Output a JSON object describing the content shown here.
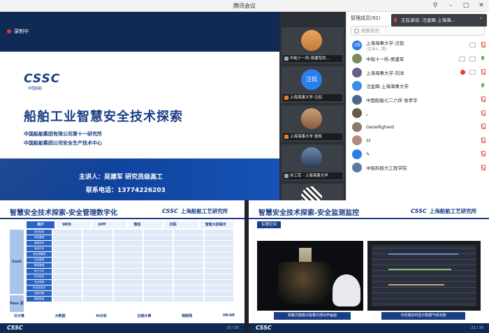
{
  "window": {
    "title": "腾讯会议"
  },
  "recording": {
    "label": "录制中"
  },
  "main_slide": {
    "logo_text": "CSSC",
    "logo_sub": "中国船舶",
    "title": "船舶工业智慧安全技术探索",
    "org_line1": "中国船舶集团有限公司第十一研究所",
    "org_line2": "中国船舶集团公司安全生产技术中心",
    "speaker": "主讲人：吴建军    研究员级高工",
    "phone": "联系电话：13774226203"
  },
  "video_tiles": [
    {
      "caption": "中船十一所-吴建军的..."
    },
    {
      "caption": "上海海事大学-汪侃",
      "avatar_text": "汪侃"
    },
    {
      "caption": "上海海事大学 张辉"
    },
    {
      "caption": "刘工军 · 上海海事大学"
    }
  ],
  "panel": {
    "header": "管理成员(92)",
    "search_placeholder": "搜索成员",
    "participants": [
      {
        "name": "上海海事大学-汪侃",
        "sub": "(主持人, 我)",
        "avatar": "汪侃",
        "color": "#2b7de9"
      },
      {
        "name": "中船十一所-吴建军",
        "sub": "",
        "avatar": "",
        "color": "#7a8c5c"
      },
      {
        "name": "上海海事大学-刘洋",
        "sub": "",
        "avatar": "",
        "color": "#6b5e8a"
      },
      {
        "name": "汪金辉-上海海事大学",
        "sub": "",
        "avatar": "汪金辉",
        "color": "#3a8de0"
      },
      {
        "name": "中国船舶七二六所 张孝华",
        "sub": "",
        "avatar": "",
        "color": "#4a6a8a"
      },
      {
        "name": "。",
        "sub": "",
        "avatar": "",
        "color": "#6a5a4a"
      },
      {
        "name": "Gezelligheid",
        "sub": "",
        "avatar": "",
        "color": "#8a7a6a"
      },
      {
        "name": "zz",
        "sub": "",
        "avatar": "",
        "color": "#b08a7a"
      },
      {
        "name": "✎",
        "sub": "",
        "avatar": "",
        "color": "#2b7de9"
      },
      {
        "name": "中船科技大工程学院",
        "sub": "",
        "avatar": "",
        "color": "#5a7aa0"
      }
    ]
  },
  "speaking_banner": {
    "text": "正在讲话: 汪金辉-上海海..."
  },
  "slide_left": {
    "title": "智慧安全技术探索-安全管理数字化",
    "logo": "CSSC",
    "logo_org": "上海船舶工艺研究所",
    "columns": [
      "用户",
      "WEB",
      "APP",
      "微信",
      "扫码",
      "智能大屏展示"
    ],
    "side_labels": [
      "SaaS 层",
      "Pass 层"
    ],
    "row_heads": [
      "安全检查",
      "风险管理",
      "隐患排查",
      "危险作业",
      "危险源管理",
      "应急管理",
      "事故管理",
      "统计分析",
      "安全培训",
      "安全审核",
      "安全信息化",
      "设施设备",
      "基础数据"
    ],
    "tech": [
      "云计算",
      "大数据",
      "AI分析",
      "边缘计算",
      "物联网",
      "VR/AR"
    ],
    "footer": "CSSC",
    "page": "15 / 25"
  },
  "slide_right": {
    "title": "智慧安全技术探索-安全监测监控",
    "logo": "CSSC",
    "logo_org": "上海船舶工艺研究所",
    "tag": "有限空间",
    "caption_left": "佩戴式摄像仪能量内部出声画面",
    "caption_right": "手机端实时显示数据气体浓度",
    "footer": "CSSC",
    "page": "21 / 25"
  }
}
